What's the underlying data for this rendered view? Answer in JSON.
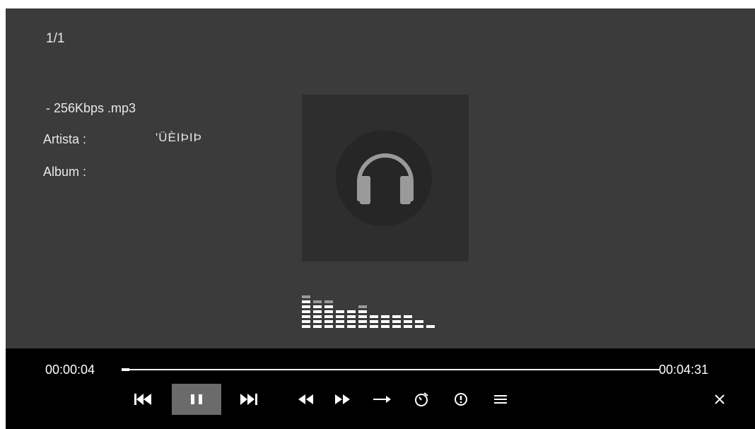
{
  "info": {
    "track_counter": "1/1",
    "file_name": "-   256Kbps .mp3",
    "artist_label": "Artista :",
    "artist_value": "'ÜÈIÞIÞ",
    "album_label": "Album :"
  },
  "playback": {
    "elapsed": "00:00:04",
    "total": "00:04:31",
    "progress_fraction": 0.015
  },
  "equalizer_levels": [
    7,
    6,
    6,
    4,
    4,
    5,
    3,
    3,
    3,
    3,
    2,
    1
  ],
  "controls": {
    "prev": "skip-previous-icon",
    "pause": "pause-icon",
    "next": "skip-next-icon",
    "rewind": "rewind-icon",
    "forward": "fast-forward-icon",
    "repeat": "arrow-right-icon",
    "timer": "timer-icon",
    "info": "info-icon",
    "playlist": "playlist-icon",
    "close": "close-icon"
  },
  "colors": {
    "screen_bg": "#3b3b3b",
    "bar_bg": "#000000",
    "pause_highlight": "#6b6b6b"
  }
}
